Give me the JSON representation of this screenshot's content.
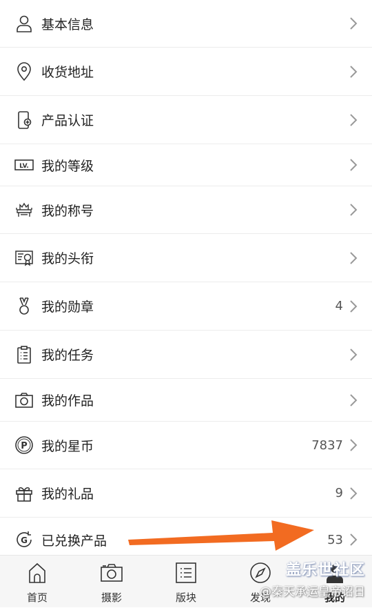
{
  "menu": {
    "items": [
      {
        "label": "基本信息",
        "icon": "person-icon",
        "count": ""
      },
      {
        "label": "收货地址",
        "icon": "location-pin-icon",
        "count": ""
      },
      {
        "label": "产品认证",
        "icon": "phone-add-icon",
        "count": ""
      },
      {
        "label": "我的等级",
        "icon": "level-badge-icon",
        "count": ""
      },
      {
        "label": "我的称号",
        "icon": "throne-icon",
        "count": ""
      },
      {
        "label": "我的头衔",
        "icon": "certificate-icon",
        "count": ""
      },
      {
        "label": "我的勋章",
        "icon": "medal-icon",
        "count": "4"
      },
      {
        "label": "我的任务",
        "icon": "clipboard-list-icon",
        "count": ""
      },
      {
        "label": "我的作品",
        "icon": "camera-icon",
        "count": ""
      },
      {
        "label": "我的星币",
        "icon": "coin-p-icon",
        "count": "7837"
      },
      {
        "label": "我的礼品",
        "icon": "gift-icon",
        "count": "9"
      },
      {
        "label": "已兑换产品",
        "icon": "exchange-g-icon",
        "count": "53"
      }
    ],
    "level_badge_text": "LV."
  },
  "tabbar": {
    "tabs": [
      {
        "label": "首页",
        "icon": "home-icon"
      },
      {
        "label": "摄影",
        "icon": "camera-icon"
      },
      {
        "label": "版块",
        "icon": "list-board-icon"
      },
      {
        "label": "发现",
        "icon": "compass-icon"
      },
      {
        "label": "我的",
        "icon": "user-icon",
        "active": true
      }
    ]
  },
  "watermark": {
    "title": "盖乐世社区",
    "subtitle": "@秦天承运皇帝诏日"
  },
  "colors": {
    "arrow": "#f26b21",
    "text": "#222222",
    "divider": "#ececec",
    "tabbar_bg": "#f6f6f6"
  }
}
